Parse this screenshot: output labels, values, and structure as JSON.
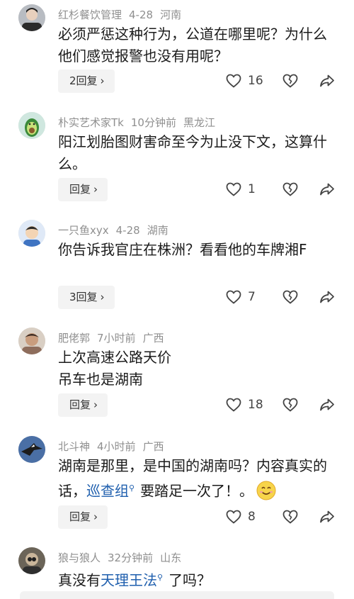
{
  "comments": [
    {
      "user": "红杉餐饮管理",
      "date": "4-28",
      "location": "河南",
      "text": "必须严惩这种行为，公道在哪里呢？为什么他们感觉报警也没有用呢？",
      "reply_label": "2回复",
      "likes": "16"
    },
    {
      "user": "朴实艺术家Tk",
      "date": "10分钟前",
      "location": "黑龙江",
      "text": "阳江划胎图财害命至今为止没下文，这算什么。",
      "reply_label": "回复",
      "likes": "1"
    },
    {
      "user": "一只鱼xyx",
      "date": "4-28",
      "location": "湖南",
      "text": "你告诉我官庄在株洲？看看他的车牌湘F",
      "reply_label": "3回复",
      "likes": "7"
    },
    {
      "user": "肥佬郭",
      "date": "7小时前",
      "location": "广西",
      "text_line1": "上次高速公路天价",
      "text_line2": "吊车也是湖南",
      "reply_label": "回复",
      "likes": "18"
    },
    {
      "user": "北斗神",
      "date": "4小时前",
      "location": "广西",
      "text_before": "湖南是那里，是中国的湖南吗？内容真实的话，",
      "link": "巡查组",
      "text_after": "要踏足一次了！。",
      "reply_label": "回复",
      "likes": "8"
    },
    {
      "user": "狼与狼人",
      "date": "32分钟前",
      "location": "山东",
      "text_before": "真没有",
      "link": "天理王法",
      "text_after": "了吗？"
    }
  ],
  "icons": {
    "like": "heart-outline-icon",
    "dislike": "broken-heart-icon",
    "share": "share-arrow-icon",
    "search_mark": "search-icon",
    "emoji": "smile-emoji-icon"
  },
  "colors": {
    "link": "#1f5fae",
    "meta": "#8f8f8f",
    "reply_bg": "#f3f3f3"
  }
}
